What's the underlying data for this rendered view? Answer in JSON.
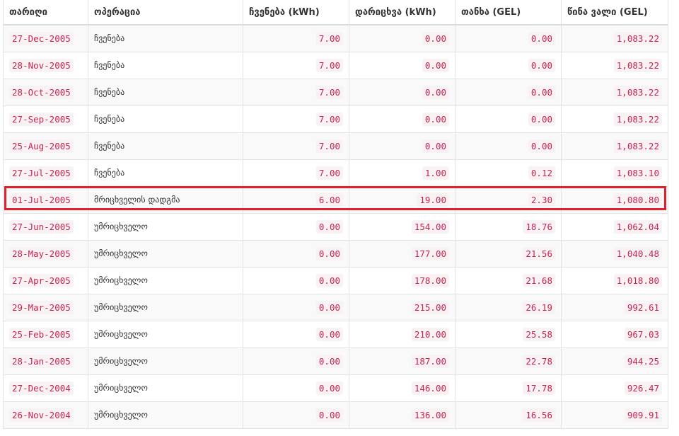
{
  "table": {
    "headers": [
      "თარიღი",
      "ოპერაცია",
      "ჩვენება (kWh)",
      "დარიცხვა (kWh)",
      "თანხა (GEL)",
      "წინა ვალი (GEL)"
    ],
    "rows": [
      {
        "date": "27-Dec-2005",
        "op": "ჩვენება",
        "reading": "7.00",
        "charge": "0.00",
        "amount": "0.00",
        "debt": "1,083.22"
      },
      {
        "date": "28-Nov-2005",
        "op": "ჩვენება",
        "reading": "7.00",
        "charge": "0.00",
        "amount": "0.00",
        "debt": "1,083.22"
      },
      {
        "date": "28-Oct-2005",
        "op": "ჩვენება",
        "reading": "7.00",
        "charge": "0.00",
        "amount": "0.00",
        "debt": "1,083.22"
      },
      {
        "date": "27-Sep-2005",
        "op": "ჩვენება",
        "reading": "7.00",
        "charge": "0.00",
        "amount": "0.00",
        "debt": "1,083.22"
      },
      {
        "date": "25-Aug-2005",
        "op": "ჩვენება",
        "reading": "7.00",
        "charge": "0.00",
        "amount": "0.00",
        "debt": "1,083.22"
      },
      {
        "date": "27-Jul-2005",
        "op": "ჩვენება",
        "reading": "7.00",
        "charge": "1.00",
        "amount": "0.12",
        "debt": "1,083.10"
      },
      {
        "date": "01-Jul-2005",
        "op": "მრიცხველის დადგმა",
        "reading": "6.00",
        "charge": "19.00",
        "amount": "2.30",
        "debt": "1,080.80"
      },
      {
        "date": "27-Jun-2005",
        "op": "უმრიცხველო",
        "reading": "0.00",
        "charge": "154.00",
        "amount": "18.76",
        "debt": "1,062.04"
      },
      {
        "date": "28-May-2005",
        "op": "უმრიცხველო",
        "reading": "0.00",
        "charge": "177.00",
        "amount": "21.56",
        "debt": "1,040.48"
      },
      {
        "date": "27-Apr-2005",
        "op": "უმრიცხველო",
        "reading": "0.00",
        "charge": "178.00",
        "amount": "21.68",
        "debt": "1,018.80"
      },
      {
        "date": "29-Mar-2005",
        "op": "უმრიცხველო",
        "reading": "0.00",
        "charge": "215.00",
        "amount": "26.19",
        "debt": "992.61"
      },
      {
        "date": "25-Feb-2005",
        "op": "უმრიცხველო",
        "reading": "0.00",
        "charge": "210.00",
        "amount": "25.58",
        "debt": "967.03"
      },
      {
        "date": "28-Jan-2005",
        "op": "უმრიცხველო",
        "reading": "0.00",
        "charge": "187.00",
        "amount": "22.78",
        "debt": "944.25"
      },
      {
        "date": "27-Dec-2004",
        "op": "უმრიცხველო",
        "reading": "0.00",
        "charge": "146.00",
        "amount": "17.78",
        "debt": "926.47"
      },
      {
        "date": "26-Nov-2004",
        "op": "უმრიცხველო",
        "reading": "0.00",
        "charge": "136.00",
        "amount": "16.56",
        "debt": "909.91"
      }
    ],
    "highlighted_row": 7
  },
  "colors": {
    "code_text": "#c7254e",
    "code_bg": "#f9f2f4",
    "highlight_border": "#e3202a"
  }
}
